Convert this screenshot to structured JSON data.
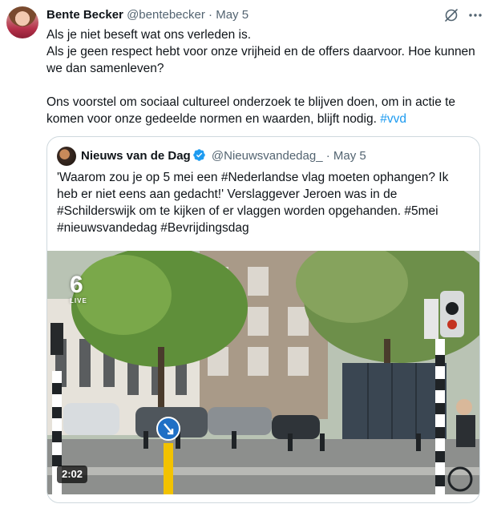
{
  "tweet": {
    "author_name": "Bente Becker",
    "handle": "@bentebecker",
    "separator": "·",
    "date": "May 5",
    "lines": [
      "Als je niet beseft wat ons verleden is.",
      "Als je geen respect hebt voor onze vrijheid en de offers daarvoor. Hoe kunnen we dan samenleven?"
    ],
    "line3": "Ons voorstel om sociaal cultureel onderzoek te blijven doen, om in actie te komen voor onze gedeelde normen en waarden, blijft nodig.",
    "hashtag": "#vvd"
  },
  "quote": {
    "author_name": "Nieuws van de Dag",
    "handle": "@Nieuwsvandedag_",
    "separator": "·",
    "date": "May 5",
    "text": "'Waarom zou je op 5 mei een #Nederlandse vlag moeten ophangen? Ik heb er niet eens aan gedacht!' Verslaggever Jeroen was in de #Schilderswijk om te kijken of er vlaggen worden opgehanden. #5mei #nieuwsvandedag #Bevrijdingsdag",
    "media": {
      "logo": "6",
      "logo_sub": "LIVE",
      "duration": "2:02"
    }
  },
  "colors": {
    "accent": "#1d9bf0",
    "text": "#0f1419",
    "muted": "#536471",
    "border": "#cfd9de"
  },
  "icons": [
    "grok-icon",
    "more-icon",
    "verified-badge-icon"
  ]
}
